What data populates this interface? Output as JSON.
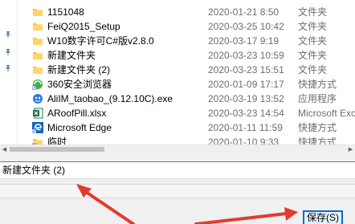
{
  "files": [
    {
      "name": "1151048",
      "date": "2020-01-21 8:50",
      "type": "文件夹",
      "icon": "folder-icon"
    },
    {
      "name": "FeiQ2015_Setup",
      "date": "2020-03-25 10:42",
      "type": "文件夹",
      "icon": "folder-icon"
    },
    {
      "name": "W10数字许可C#版v2.8.0",
      "date": "2020-03-17 9:19",
      "type": "文件夹",
      "icon": "folder-icon"
    },
    {
      "name": "新建文件夹",
      "date": "2020-03-23 10:59",
      "type": "文件夹",
      "icon": "folder-icon"
    },
    {
      "name": "新建文件夹 (2)",
      "date": "2020-03-23 15:51",
      "type": "文件夹",
      "icon": "folder-icon"
    },
    {
      "name": "360安全浏览器",
      "date": "2020-01-09 17:17",
      "type": "快捷方式",
      "icon": "browser-shortcut-icon"
    },
    {
      "name": "AliIM_taobao_(9.12.10C).exe",
      "date": "2020-03-19 13:52",
      "type": "应用程序",
      "icon": "app-icon"
    },
    {
      "name": "ARoofPill.xlsx",
      "date": "2020-03-23 14:54",
      "type": "Microsoft Exc",
      "icon": "excel-icon"
    },
    {
      "name": "Microsoft Edge",
      "date": "2020-01-11 11:59",
      "type": "快捷方式",
      "icon": "edge-shortcut-icon"
    },
    {
      "name": "临时",
      "date": "2020-01-10 9:33",
      "type": "快捷方式",
      "icon": "folder-shortcut-icon"
    }
  ],
  "filename_value": "新建文件夹 (2)",
  "save_label": "保存(S)",
  "colors": {
    "folder": "#f6c343",
    "annotation_arrow": "#e23b2e",
    "button_border": "#0a6acc"
  }
}
